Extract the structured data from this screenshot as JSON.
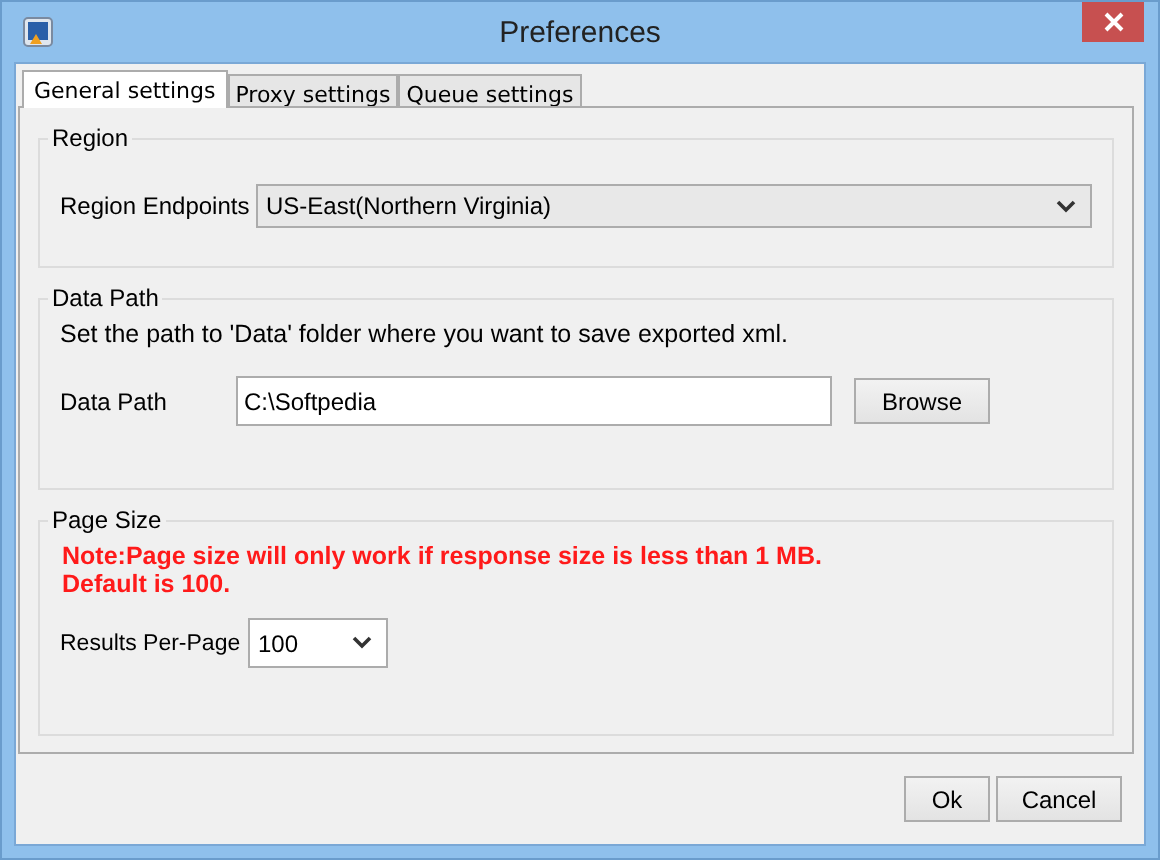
{
  "window": {
    "title": "Preferences"
  },
  "tabs": [
    {
      "label": "General settings",
      "selected": true
    },
    {
      "label": "Proxy settings",
      "selected": false
    },
    {
      "label": "Queue settings",
      "selected": false
    }
  ],
  "region": {
    "title": "Region",
    "label": "Region Endpoints",
    "value": "US-East(Northern Virginia)"
  },
  "data_path": {
    "title": "Data Path",
    "description": "Set the path to 'Data' folder where you want to save exported xml.",
    "label": "Data Path",
    "value": "C:\\Softpedia",
    "button": "Browse"
  },
  "page_size": {
    "title": "Page Size",
    "notes": [
      "Note:Page size will only work if response size is less than 1 MB.",
      "Default is 100."
    ],
    "label": "Results Per-Page",
    "value": "100"
  },
  "buttons": [
    "Ok",
    "Cancel"
  ]
}
